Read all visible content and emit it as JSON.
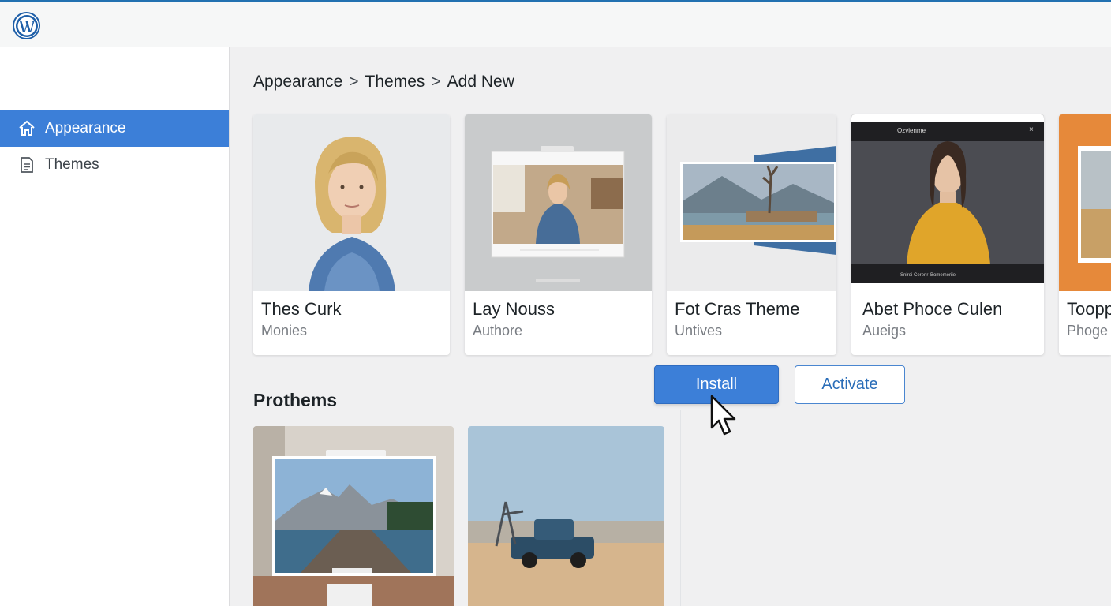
{
  "app": {
    "logo_icon": "wordpress-logo-icon",
    "accent_color": "#3c7fd8"
  },
  "sidebar": {
    "items": [
      {
        "label": "Appearance",
        "icon": "home-icon",
        "active": true
      },
      {
        "label": "Themes",
        "icon": "document-icon",
        "active": false
      }
    ]
  },
  "breadcrumb": {
    "items": [
      "Appearance",
      "Themes",
      "Add New"
    ],
    "separator": ">"
  },
  "themes": [
    {
      "name": "Thes Curk",
      "author": "Monies"
    },
    {
      "name": "Lay Nouss",
      "author": "Authore"
    },
    {
      "name": "Fot Cras Theme",
      "author": "Untives"
    },
    {
      "name": "Abet Phoce Culen",
      "author": "Aueigs"
    },
    {
      "name": "Toopp",
      "author": "Phoge"
    }
  ],
  "preview_screen": {
    "title": "Ozvienme",
    "footer_left": "Snirei Cerenr",
    "footer_right": "Bomemeriie"
  },
  "actions": {
    "install_label": "Install",
    "activate_label": "Activate"
  },
  "section": {
    "title": "Prothems"
  }
}
